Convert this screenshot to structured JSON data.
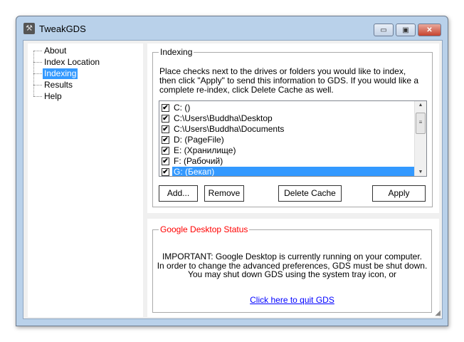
{
  "window": {
    "title": "TweakGDS",
    "minimize": "▭",
    "maximize": "▣",
    "close": "✕"
  },
  "tree": {
    "items": [
      {
        "label": "About"
      },
      {
        "label": "Index Location"
      },
      {
        "label": "Indexing",
        "selected": true
      },
      {
        "label": "Results"
      },
      {
        "label": "Help"
      }
    ]
  },
  "indexing": {
    "group_label": "Indexing",
    "instructions": "Place checks next to the drives or folders you would like to index, then click \"Apply\" to send this information to GDS.  If you would like a complete re-index, click Delete Cache as well.",
    "items": [
      {
        "label": "C: ()",
        "checked": true
      },
      {
        "label": "C:\\Users\\Buddha\\Desktop",
        "checked": true
      },
      {
        "label": "C:\\Users\\Buddha\\Documents",
        "checked": true
      },
      {
        "label": "D: (PageFile)",
        "checked": true
      },
      {
        "label": "E: (Хранилище)",
        "checked": true
      },
      {
        "label": "F: (Рабочий)",
        "checked": true
      },
      {
        "label": "G: (Бекап)",
        "checked": true,
        "selected": true
      }
    ],
    "buttons": {
      "add": "Add...",
      "remove": "Remove",
      "delete_cache": "Delete Cache",
      "apply": "Apply"
    }
  },
  "status": {
    "group_label": "Google Desktop Status",
    "label_color": "#ff0000",
    "lines": [
      "IMPORTANT: Google Desktop is currently running on your computer.",
      "In order to change the advanced preferences, GDS must be shut down.",
      "You may shut down GDS using the system tray icon, or"
    ],
    "link": "Click here to quit GDS"
  }
}
